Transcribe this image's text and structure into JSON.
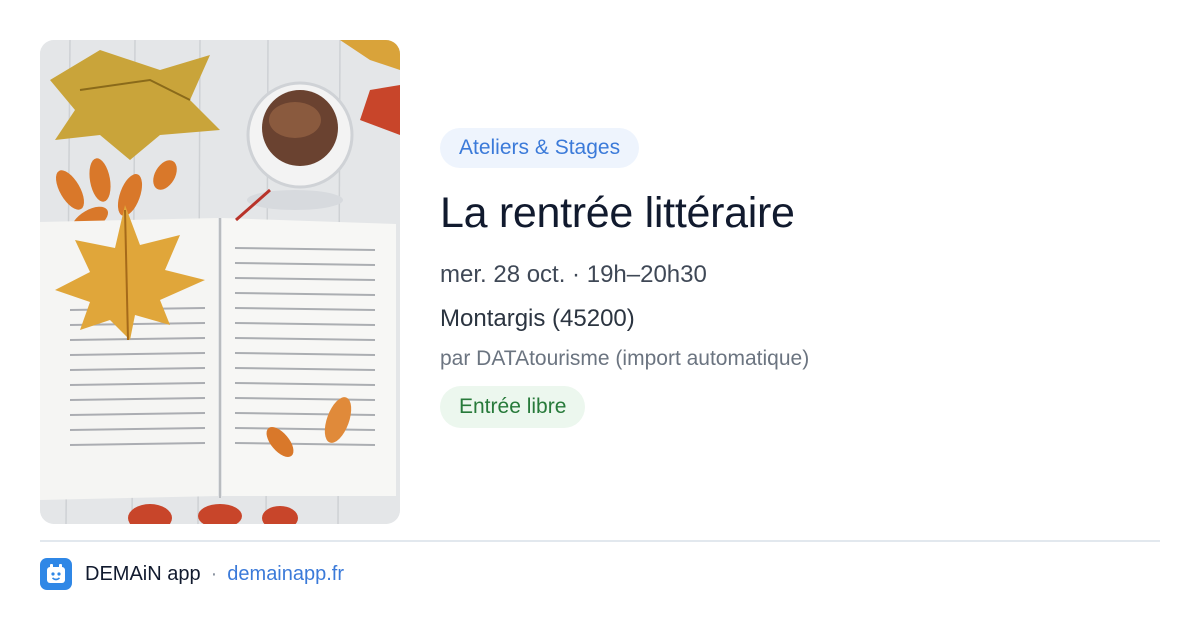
{
  "event": {
    "category": "Ateliers & Stages",
    "title": "La rentrée littéraire",
    "datetime": "mer. 28 oct. · 19h–20h30",
    "location": "Montargis (45200)",
    "organizer": "par DATAtourisme (import automatique)",
    "price": "Entrée libre",
    "image_icon": "book-coffee-autumn-leaves-photo"
  },
  "footer": {
    "app_name": "DEMAiN app",
    "separator": "·",
    "url": "demainapp.fr",
    "logo_icon": "demain-app-logo-icon"
  },
  "colors": {
    "category_bg": "#eef4fd",
    "category_text": "#3b7ad9",
    "price_bg": "#ecf7ee",
    "price_text": "#277a3a",
    "link": "#3b7ad9",
    "logo": "#2f87e6"
  }
}
